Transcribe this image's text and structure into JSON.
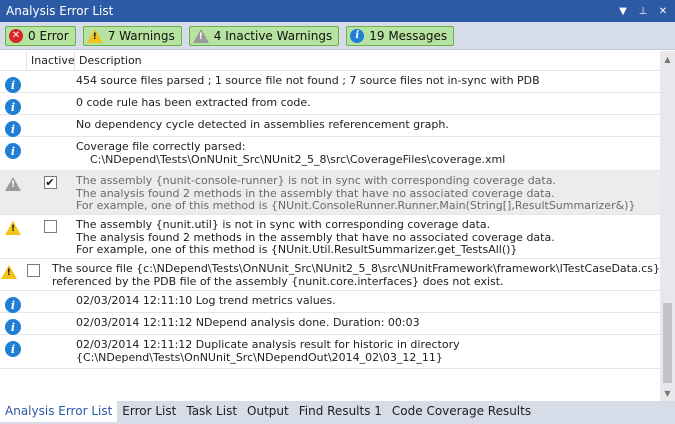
{
  "window": {
    "title": "Analysis Error List"
  },
  "toolbar": {
    "errors_label": "0 Error",
    "warnings_label": "7 Warnings",
    "inactive_warnings_label": "4 Inactive Warnings",
    "messages_label": "19 Messages"
  },
  "columns": {
    "inactive": "Inactive",
    "description": "Description"
  },
  "rows": [
    {
      "type": "info",
      "inactive": null,
      "lines": [
        "454 source files parsed ; 1 source file not found ; 7 source files not in-sync with PDB"
      ]
    },
    {
      "type": "info",
      "inactive": null,
      "lines": [
        "0 code rule has been extracted from code."
      ]
    },
    {
      "type": "info",
      "inactive": null,
      "lines": [
        "No dependency cycle detected in assemblies referencement graph."
      ]
    },
    {
      "type": "info",
      "inactive": null,
      "lines": [
        "Coverage file correctly parsed:",
        "    C:\\NDepend\\Tests\\OnNUnit_Src\\NUnit2_5_8\\src\\CoverageFiles\\coverage.xml"
      ]
    },
    {
      "type": "warning-inactive",
      "inactive": true,
      "lines": [
        "The assembly {nunit-console-runner} is not in sync with corresponding coverage data.",
        "The analysis found 2 methods in the assembly that have no associated coverage data.",
        "For example, one of this method is {NUnit.ConsoleRunner.Runner.Main(String[],ResultSummarizer&)}"
      ]
    },
    {
      "type": "warning",
      "inactive": false,
      "lines": [
        "The assembly {nunit.util} is not in sync with corresponding coverage data.",
        "The analysis found 2 methods in the assembly that have no associated coverage data.",
        "For example, one of this method is {NUnit.Util.ResultSummarizer.get_TestsAll()}"
      ]
    },
    {
      "type": "warning",
      "inactive": false,
      "lines": [
        "The source file {c:\\NDepend\\Tests\\OnNUnit_Src\\NUnit2_5_8\\src\\NUnitFramework\\framework\\ITestCaseData.cs}",
        "referenced by the PDB file of the assembly {nunit.core.interfaces} does not exist."
      ]
    },
    {
      "type": "info",
      "inactive": null,
      "lines": [
        "02/03/2014 12:11:10 Log trend metrics values."
      ]
    },
    {
      "type": "info",
      "inactive": null,
      "lines": [
        "02/03/2014 12:11:12 NDepend analysis done. Duration: 00:03"
      ]
    },
    {
      "type": "info",
      "inactive": null,
      "lines": [
        "02/03/2014 12:11:12 Duplicate analysis result for historic in directory",
        "{C:\\NDepend\\Tests\\OnNUnit_Src\\NDependOut\\2014_02\\03_12_11}"
      ]
    }
  ],
  "tabs": [
    "Analysis Error List",
    "Error List",
    "Task List",
    "Output",
    "Find Results 1",
    "Code Coverage Results"
  ],
  "active_tab": "Analysis Error List"
}
